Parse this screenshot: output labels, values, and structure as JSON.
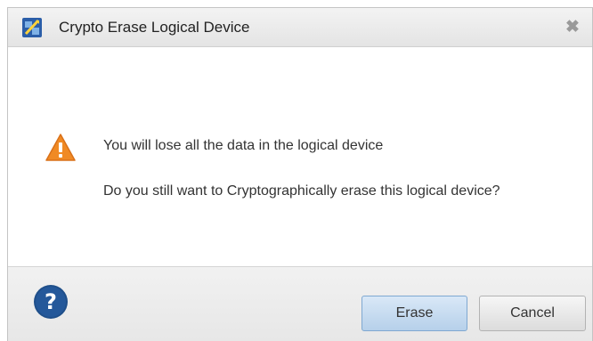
{
  "dialog": {
    "title": "Crypto Erase Logical Device",
    "close_glyph": "✖",
    "app_icon": "app-logo-icon",
    "warning_icon": "warning-triangle-icon",
    "message_line1": "You will lose all the data in the logical device",
    "message_line2": "Do you still want to Cryptographically erase this logical device?",
    "help_icon": "help-question-icon",
    "buttons": {
      "erase_label": "Erase",
      "cancel_label": "Cancel"
    }
  },
  "colors": {
    "warning": "#f08a24",
    "help": "#1f4f8a",
    "primary_button": "#c7dcf0",
    "title_bar": "#e9e9e9"
  }
}
